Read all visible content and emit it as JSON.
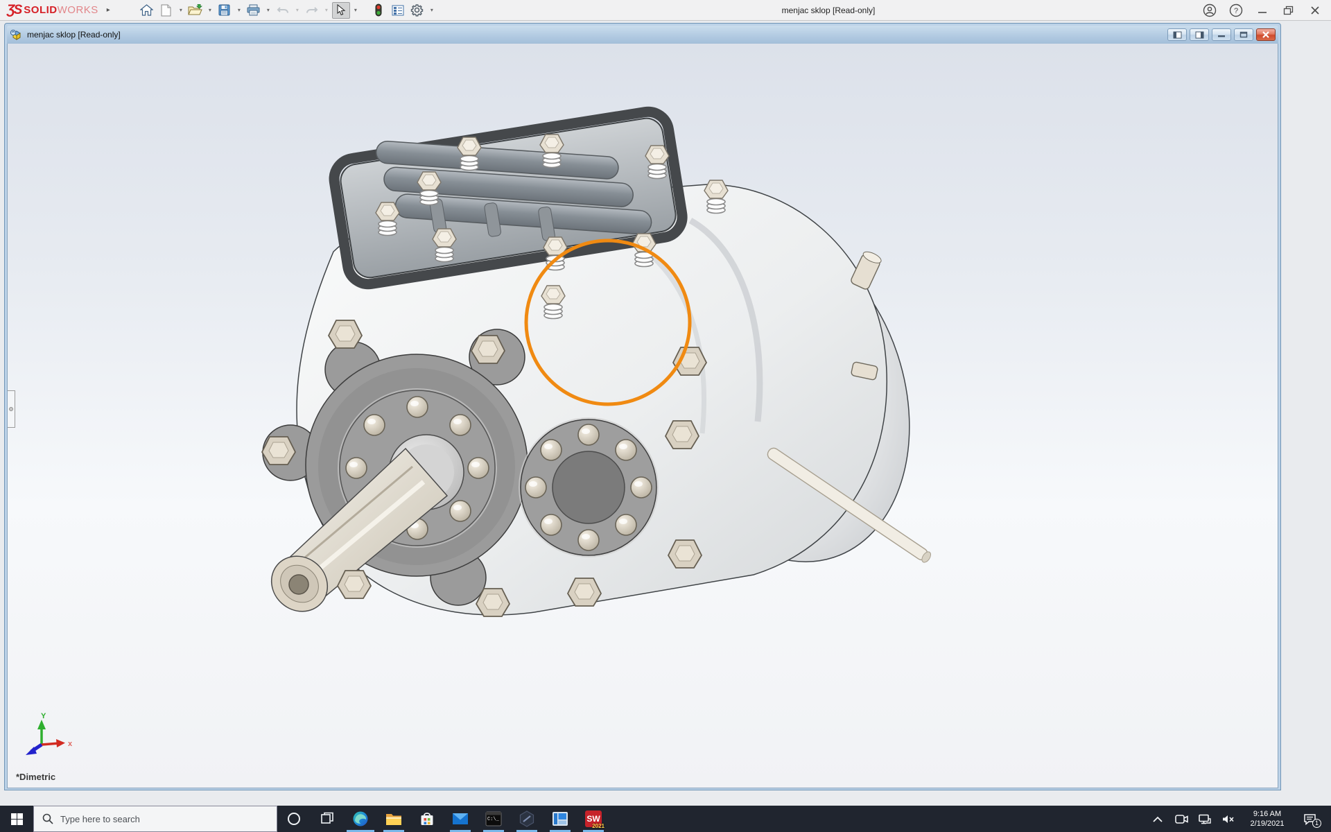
{
  "app": {
    "brand": {
      "glyph": "ƷS",
      "name_bold": "SOLID",
      "name_light": "WORKS",
      "expand": "▸"
    },
    "title": "menjac sklop [Read-only]",
    "toolbar_icons": [
      "home",
      "new-document",
      "open",
      "save",
      "print",
      "undo",
      "redo",
      "select-arrow",
      "appearance-stoplight",
      "property-manager",
      "options-gear"
    ],
    "window_controls": [
      "account",
      "help",
      "minimize",
      "restore",
      "close"
    ]
  },
  "document_window": {
    "title": "menjac sklop [Read-only]",
    "controls": [
      "pane-left",
      "pane-right",
      "minimize",
      "restore",
      "close"
    ]
  },
  "viewport": {
    "view_label": "*Dimetric",
    "triad_y": "Y",
    "triad_x": "x",
    "annotation": {
      "shape": "circle",
      "color": "#f08a12"
    }
  },
  "taskbar": {
    "search_placeholder": "Type here to search",
    "icons": [
      "start",
      "search",
      "cortana",
      "task-view",
      "edge",
      "file-explorer",
      "store",
      "mail",
      "command-prompt",
      "hexagon-app",
      "blue-window-app",
      "solidworks-2021"
    ],
    "running_indicator_color": "#79b8ea",
    "sw_icon": {
      "letters": "SW",
      "year": "2021"
    },
    "tray_icons": [
      "hidden-icons-chevron",
      "meet-now-camera",
      "network",
      "volume-muted",
      "clock",
      "action-center"
    ],
    "clock_time": "9:16 AM",
    "clock_date": "2/19/2021",
    "notification_count": "1"
  },
  "colors": {
    "taskbar_bg": "#20252f",
    "doc_titlebar_top": "#cadded",
    "doc_titlebar_bottom": "#a3bed9",
    "annotation_orange": "#f08a12",
    "close_button_red": "#cf4a2c",
    "brand_red": "#d61f26"
  }
}
